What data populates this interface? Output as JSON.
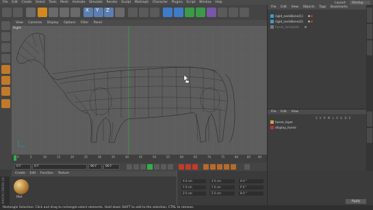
{
  "menubar": {
    "items": [
      "File",
      "Edit",
      "Create",
      "Select",
      "Tools",
      "Mesh",
      "Animate",
      "Simulate",
      "Render",
      "Sculpt",
      "MoGraph",
      "Character",
      "Plugins",
      "Script",
      "Window",
      "Help"
    ],
    "layout_label": "Layout:",
    "layout_value": "Startup"
  },
  "viewport": {
    "menu": [
      "View",
      "Cameras",
      "Display",
      "Options",
      "Filter",
      "Panel"
    ],
    "label": "Right"
  },
  "timeline": {
    "ticks": [
      "0",
      "5",
      "10",
      "15",
      "20",
      "25",
      "30",
      "35",
      "40",
      "45",
      "50",
      "55",
      "60",
      "65",
      "70",
      "75",
      "80",
      "85",
      "90"
    ],
    "current_frame_label": "0 F",
    "start_field": "0 F",
    "end_field": "90 F",
    "min_field": "0 F",
    "max_field": "90 F"
  },
  "object_manager": {
    "menu": [
      "File",
      "Edit",
      "View",
      "Objects",
      "Tags",
      "Bookmarks"
    ],
    "objects": [
      {
        "name": "rigid_neckBone(1)"
      },
      {
        "name": "rigid_neckBone(2)"
      },
      {
        "name": "horse_template"
      }
    ]
  },
  "layer_manager": {
    "menu": [
      "File",
      "Edit",
      "View"
    ],
    "columns_label": "S V R M L A G D E",
    "layers": [
      {
        "name": "horse_layer",
        "color": "#c8a14a"
      },
      {
        "name": "display_horse",
        "color": "#c03030"
      }
    ]
  },
  "material_manager": {
    "menu": [
      "Create",
      "Edit",
      "Function",
      "Texture"
    ],
    "material_label": "Mat",
    "brand_text": "MAXON CINEMA 4D"
  },
  "coordinates": {
    "rows": [
      {
        "axis": "X",
        "pos": "0 cm",
        "axis2": "X",
        "size": "0 cm",
        "axis3": "H",
        "rot": "0 °"
      },
      {
        "axis": "Y",
        "pos": "0 cm",
        "axis2": "Y",
        "size": "0 cm",
        "axis3": "P",
        "rot": "0 °"
      },
      {
        "axis": "Z",
        "pos": "0 cm",
        "axis2": "Z",
        "size": "0 cm",
        "axis3": "B",
        "rot": "0 °"
      }
    ],
    "apply_label": "Apply"
  },
  "status_text": "Rectangle Selection: Click and drag to rectangle-select elements. Hold down SHIFT to add to the selection, CTRL to remove.",
  "colors": {
    "accent_blue": "#3d7cc9",
    "timeline_green": "#2fb04a",
    "record_red": "#c23a2a"
  }
}
